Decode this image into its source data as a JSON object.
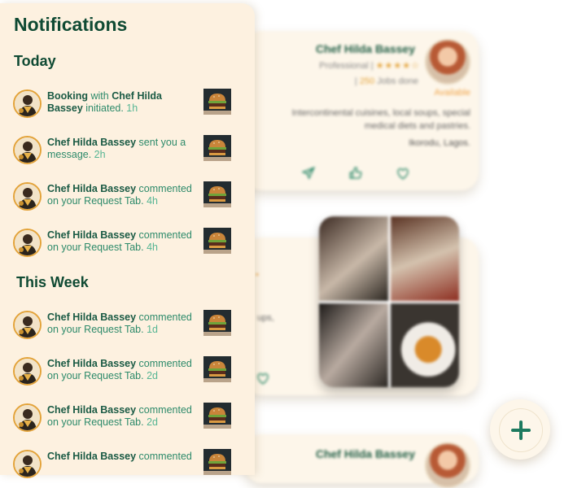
{
  "panel": {
    "title": "Notifications",
    "sections": [
      {
        "title": "Today",
        "items": [
          {
            "lead": "Booking",
            "mid": " with ",
            "name": "Chef Hilda Bassey",
            "rest": " initiated.",
            "time": " 1h"
          },
          {
            "lead": "",
            "mid": "",
            "name": "Chef Hilda Bassey",
            "rest": " sent you a message.",
            "time": " 2h"
          },
          {
            "lead": "",
            "mid": "",
            "name": "Chef Hilda Bassey",
            "rest": " commented on your Request Tab.",
            "time": " 4h"
          },
          {
            "lead": "",
            "mid": "",
            "name": "Chef Hilda Bassey",
            "rest": " commented on your Request Tab.",
            "time": " 4h"
          }
        ]
      },
      {
        "title": "This Week",
        "items": [
          {
            "lead": "",
            "mid": "",
            "name": "Chef Hilda Bassey",
            "rest": " commented on your Request Tab.",
            "time": " 1d"
          },
          {
            "lead": "",
            "mid": "",
            "name": "Chef Hilda Bassey",
            "rest": " commented on your Request Tab.",
            "time": " 2d"
          },
          {
            "lead": "",
            "mid": "",
            "name": "Chef Hilda Bassey",
            "rest": " commented on your Request Tab.",
            "time": " 2d"
          },
          {
            "lead": "",
            "mid": "",
            "name": "Chef Hilda Bassey",
            "rest": " commented",
            "time": ""
          }
        ]
      }
    ]
  },
  "background": {
    "card1": {
      "name": "Chef Hilda Bassey",
      "level": "Professional |",
      "stars": "★★★★☆",
      "jobs_prefix": "| ",
      "jobs_count": "250",
      "jobs_suffix": " Jobs done",
      "status": "Available",
      "description": "Intercontinental cuisines, local soups, special medical diets and pastries.",
      "location": "Ikorodu, Lagos."
    },
    "card2": {
      "fragment_top": "•",
      "fragment_text": "ups,"
    },
    "card3": {
      "name": "Chef Hilda Bassey"
    }
  },
  "colors": {
    "brand_green": "#0f4a33",
    "accent_green": "#2d8a6a",
    "time_green": "#55b593",
    "accent_orange": "#e3a33a",
    "panel_bg": "#fdf1e0"
  },
  "icons": {
    "avatar": "chef-avatar-icon",
    "thumbnail": "burger-thumbnail",
    "fab": "plus-icon",
    "share": "send-icon",
    "like": "thumbs-up-icon",
    "favorite": "heart-icon"
  }
}
